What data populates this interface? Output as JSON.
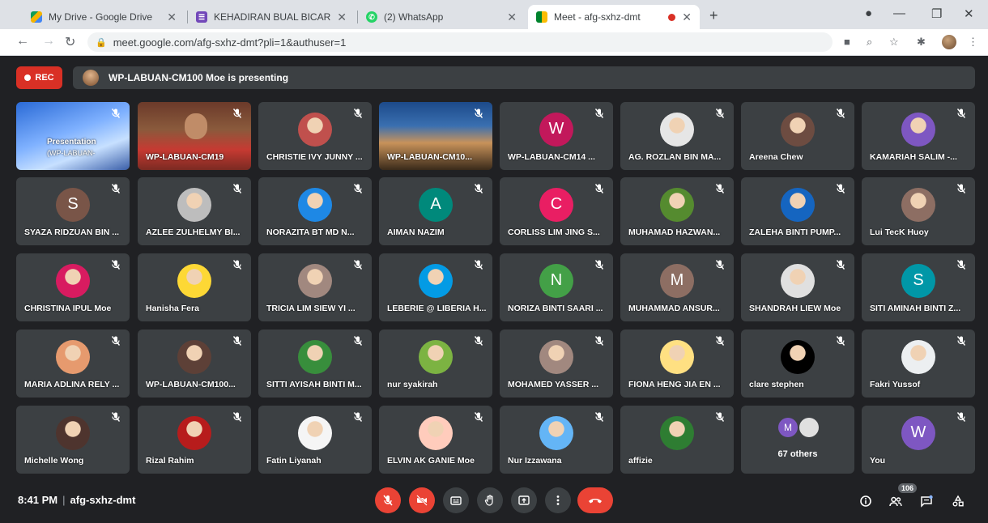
{
  "browser": {
    "tabs": [
      {
        "title": "My Drive - Google Drive",
        "favicon": "google-drive-icon"
      },
      {
        "title": "KEHADIRAN BUAL BICARA CIKGU",
        "favicon": "google-forms-icon"
      },
      {
        "title": "(2) WhatsApp",
        "favicon": "whatsapp-icon"
      },
      {
        "title": "Meet - afg-sxhz-dmt",
        "favicon": "google-meet-icon"
      }
    ],
    "url": "meet.google.com/afg-sxhz-dmt?pli=1&authuser=1"
  },
  "meet": {
    "rec_label": "REC",
    "presenting_text": "WP-LABUAN-CM100 Moe is presenting",
    "time": "8:41 PM",
    "meeting_code": "afg-sxhz-dmt",
    "participant_count": "106",
    "colors": {
      "accent_red": "#ea4335",
      "tile": "#3c4043",
      "background": "#202124"
    },
    "presentation_tile": {
      "title": "Presentation",
      "subtitle": "(WP-LABUAN-"
    },
    "tiles": [
      {
        "name": "",
        "kind": "presentation"
      },
      {
        "name": "WP-LABUAN-CM19",
        "kind": "video"
      },
      {
        "name": "CHRISTIE IVY JUNNY ...",
        "kind": "photo",
        "color": "#c0504d"
      },
      {
        "name": "WP-LABUAN-CM10...",
        "kind": "video2"
      },
      {
        "name": "WP-LABUAN-CM14 ...",
        "kind": "letter",
        "letter": "W",
        "color": "#c2185b"
      },
      {
        "name": "AG. ROZLAN BIN MA...",
        "kind": "photo",
        "color": "#e6e6e6"
      },
      {
        "name": "Areena Chew",
        "kind": "photo",
        "color": "#6d4c41"
      },
      {
        "name": "KAMARIAH SALIM -...",
        "kind": "photo",
        "color": "#7e57c2"
      },
      {
        "name": "SYAZA RIDZUAN BIN ...",
        "kind": "letter",
        "letter": "S",
        "color": "#795548"
      },
      {
        "name": "AZLEE ZULHELMY BI...",
        "kind": "photo",
        "color": "#bdbdbd"
      },
      {
        "name": "NORAZITA BT MD N...",
        "kind": "photo",
        "color": "#1e88e5"
      },
      {
        "name": "AIMAN NAZIM",
        "kind": "letter",
        "letter": "A",
        "color": "#00897b"
      },
      {
        "name": "CORLISS LIM JING S...",
        "kind": "letter",
        "letter": "C",
        "color": "#e91e63"
      },
      {
        "name": "MUHAMAD HAZWAN...",
        "kind": "photo",
        "color": "#558b2f"
      },
      {
        "name": "ZALEHA BINTI PUMP...",
        "kind": "photo",
        "color": "#1565c0"
      },
      {
        "name": "Lui TecK Huoy",
        "kind": "photo",
        "color": "#8d6e63"
      },
      {
        "name": "CHRISTINA IPUL Moe",
        "kind": "photo",
        "color": "#d81b60"
      },
      {
        "name": "Hanisha Fera",
        "kind": "photo",
        "color": "#fdd835"
      },
      {
        "name": "TRICIA LIM SIEW YI ...",
        "kind": "photo",
        "color": "#a1887f"
      },
      {
        "name": "LEBERIE @ LIBERIA H...",
        "kind": "photo",
        "color": "#039be5"
      },
      {
        "name": "NORIZA BINTI SAARI ...",
        "kind": "letter",
        "letter": "N",
        "color": "#43a047"
      },
      {
        "name": "MUHAMMAD ANSUR...",
        "kind": "letter",
        "letter": "M",
        "color": "#8d6e63"
      },
      {
        "name": "SHANDRAH LIEW Moe",
        "kind": "photo",
        "color": "#e0e0e0"
      },
      {
        "name": "SITI AMINAH BINTI Z...",
        "kind": "letter",
        "letter": "S",
        "color": "#0097a7"
      },
      {
        "name": "MARIA ADLINA RELY ...",
        "kind": "photo",
        "color": "#e69a6e"
      },
      {
        "name": "WP-LABUAN-CM100...",
        "kind": "photo",
        "color": "#5d4037"
      },
      {
        "name": "SITTI AYISAH BINTI M...",
        "kind": "photo",
        "color": "#388e3c"
      },
      {
        "name": "nur syakirah",
        "kind": "photo",
        "color": "#7cb342"
      },
      {
        "name": "MOHAMED YASSER ...",
        "kind": "photo",
        "color": "#a1887f"
      },
      {
        "name": "FIONA HENG JIA EN ...",
        "kind": "photo",
        "color": "#ffe082"
      },
      {
        "name": "clare stephen",
        "kind": "photo",
        "color": "#000000"
      },
      {
        "name": "Fakri Yussof",
        "kind": "photo",
        "color": "#eceff1"
      },
      {
        "name": "Michelle Wong",
        "kind": "photo",
        "color": "#4e342e"
      },
      {
        "name": "Rizal Rahim",
        "kind": "photo",
        "color": "#b71c1c"
      },
      {
        "name": "Fatin Liyanah",
        "kind": "photo",
        "color": "#f5f5f5"
      },
      {
        "name": "ELVIN AK GANIE Moe",
        "kind": "photo",
        "color": "#ffccbc"
      },
      {
        "name": "Nur Izzawana",
        "kind": "photo",
        "color": "#64b5f6"
      },
      {
        "name": "affizie",
        "kind": "photo",
        "color": "#2e7d32"
      },
      {
        "name": "67 others",
        "kind": "others",
        "letter": "M",
        "color": "#7e57c2"
      },
      {
        "name": "You",
        "kind": "letter",
        "letter": "W",
        "color": "#7e57c2"
      }
    ]
  }
}
